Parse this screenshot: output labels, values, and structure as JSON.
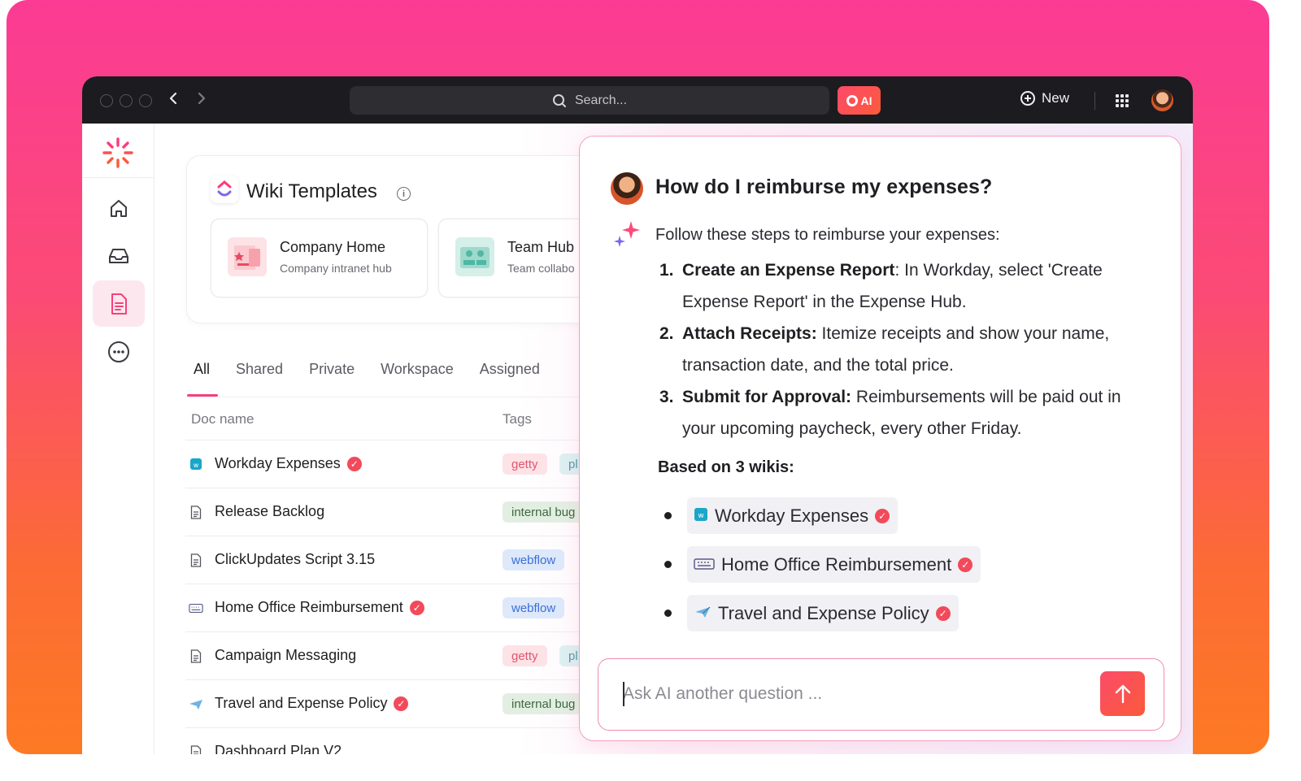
{
  "titlebar": {
    "search_placeholder": "Search...",
    "ai_label": "AI",
    "new_label": "New"
  },
  "wiki": {
    "title": "Wiki Templates",
    "templates": [
      {
        "title": "Company Home",
        "subtitle": "Company intranet hub"
      },
      {
        "title": "Team Hub",
        "subtitle": "Team collabo"
      }
    ]
  },
  "tabs": [
    "All",
    "Shared",
    "Private",
    "Workspace",
    "Assigned"
  ],
  "table": {
    "headers": {
      "name": "Doc name",
      "tags": "Tags"
    },
    "rows": [
      {
        "name": "Workday Expenses",
        "icon": "workday-icon",
        "verified": true,
        "tag": "getty",
        "tag_type": "getty",
        "tag2": "pl"
      },
      {
        "name": "Release Backlog",
        "icon": "doc-icon",
        "verified": false,
        "tag": "internal bug",
        "tag_type": "internal",
        "tag2": ""
      },
      {
        "name": "ClickUpdates Script 3.15",
        "icon": "doc-icon",
        "verified": false,
        "tag": "webflow",
        "tag_type": "webflow",
        "tag2": ""
      },
      {
        "name": "Home Office Reimbursement",
        "icon": "keyboard-icon",
        "verified": true,
        "tag": "webflow",
        "tag_type": "webflow",
        "tag2": ""
      },
      {
        "name": "Campaign Messaging",
        "icon": "doc-icon",
        "verified": false,
        "tag": "getty",
        "tag_type": "getty",
        "tag2": "pl"
      },
      {
        "name": "Travel and Expense Policy",
        "icon": "plane-icon",
        "verified": true,
        "tag": "internal bug",
        "tag_type": "internal",
        "tag2": ""
      },
      {
        "name": "Dashboard Plan V2",
        "icon": "doc-icon",
        "verified": false,
        "tag": "",
        "tag_type": "",
        "tag2": ""
      }
    ]
  },
  "ai": {
    "question": "How do I reimburse my expenses?",
    "intro": "Follow these steps to reimburse your expenses:",
    "steps": [
      {
        "num": "1.",
        "title": "Create an Expense Report",
        "text": ": In Workday, select 'Create Expense Report' in the Expense Hub."
      },
      {
        "num": "2.",
        "title": "Attach Receipts:",
        "text": " Itemize receipts and show your name, transaction date, and the total price."
      },
      {
        "num": "3.",
        "title": "Submit for Approval:",
        "text": "  Reimbursements will be paid out in your upcoming paycheck, every other Friday."
      }
    ],
    "based_on": "Based on 3 wikis:",
    "sources": [
      {
        "name": "Workday Expenses",
        "icon": "workday-icon"
      },
      {
        "name": "Home Office Reimbursement",
        "icon": "keyboard-icon"
      },
      {
        "name": "Travel and Expense Policy",
        "icon": "plane-icon"
      }
    ],
    "ask_placeholder": "Ask AI another question ..."
  },
  "colors": {
    "accent": "#f5417a",
    "ai_button": "#fb5b3b",
    "verified": "#f24a5a"
  }
}
